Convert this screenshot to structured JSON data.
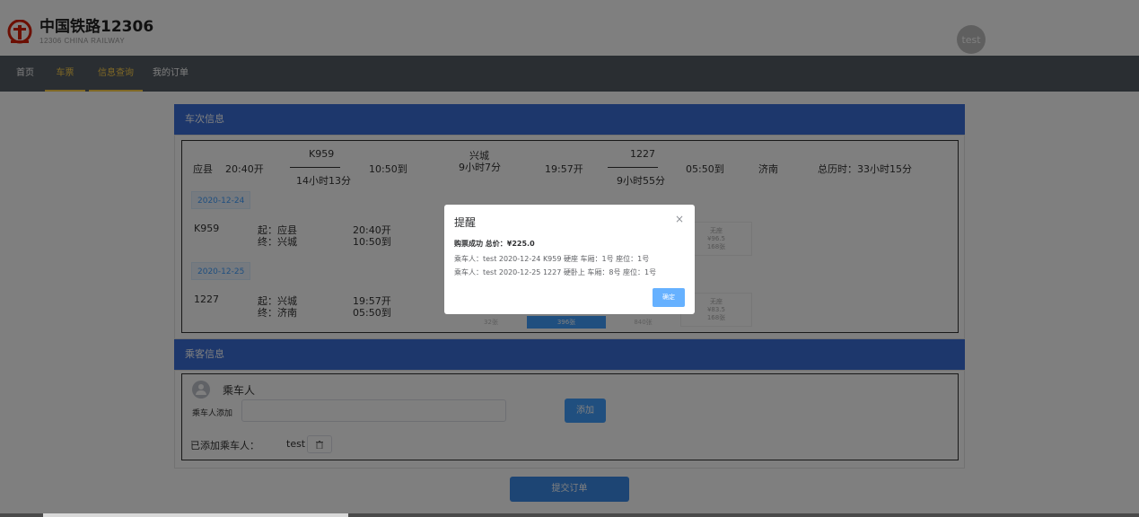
{
  "header": {
    "brand_cn": "中国铁路12306",
    "brand_en": "12306 CHINA RAILWAY",
    "avatar_text": "test"
  },
  "nav": {
    "items": [
      {
        "label": "首页"
      },
      {
        "label": "车票"
      },
      {
        "label": "信息查询"
      },
      {
        "label": "我的订单"
      }
    ]
  },
  "trip": {
    "section_title": "车次信息",
    "from": "应县",
    "depart_time_1": "20:40开",
    "train_1": "K959",
    "duration_1": "14小时13分",
    "arrive_time_1": "10:50到",
    "transfer_station": "兴城",
    "transfer_wait": "9小时7分",
    "depart_time_2": "19:57开",
    "train_2": "1227",
    "duration_2": "9小时55分",
    "arrive_time_2": "05:50到",
    "to": "济南",
    "total_time": "总历时：33小时15分"
  },
  "legs": [
    {
      "date": "2020-12-24",
      "train": "K959",
      "from": "起：应县",
      "to": "终：兴城",
      "depart": "20:40开",
      "arrive": "10:50到",
      "seat_name": "无座",
      "seat_price": "¥96.5",
      "seat_count": "168张"
    },
    {
      "date": "2020-12-25",
      "train": "1227",
      "from": "起：兴城",
      "to": "终：济南",
      "depart": "19:57开",
      "arrive": "05:50到",
      "seat_name": "无座",
      "seat_price": "¥83.5",
      "seat_count": "168张",
      "strip_counts": [
        "32张",
        "396张",
        "840张"
      ]
    }
  ],
  "passenger": {
    "section_title": "乘客信息",
    "heading": "乘车人",
    "add_label": "乘车人添加",
    "add_input_value": "",
    "add_button": "添加",
    "added_label": "已添加乘车人：",
    "added_name": "test"
  },
  "submit_button": "提交订单",
  "dialog": {
    "title": "提醒",
    "close_glyph": "×",
    "line1": "购票成功 总价：¥225.0",
    "line2": "乘车人：test 2020-12-24 K959 硬座 车厢：1号 座位：1号",
    "line3": "乘车人：test 2020-12-25 1227 硬卧上 车厢：8号 座位：1号",
    "ok_button": "确定"
  },
  "colors": {
    "nav_bg": "#545c64",
    "nav_active": "#ffd04b",
    "section_head": "#3a6fd8",
    "primary": "#409eff"
  }
}
